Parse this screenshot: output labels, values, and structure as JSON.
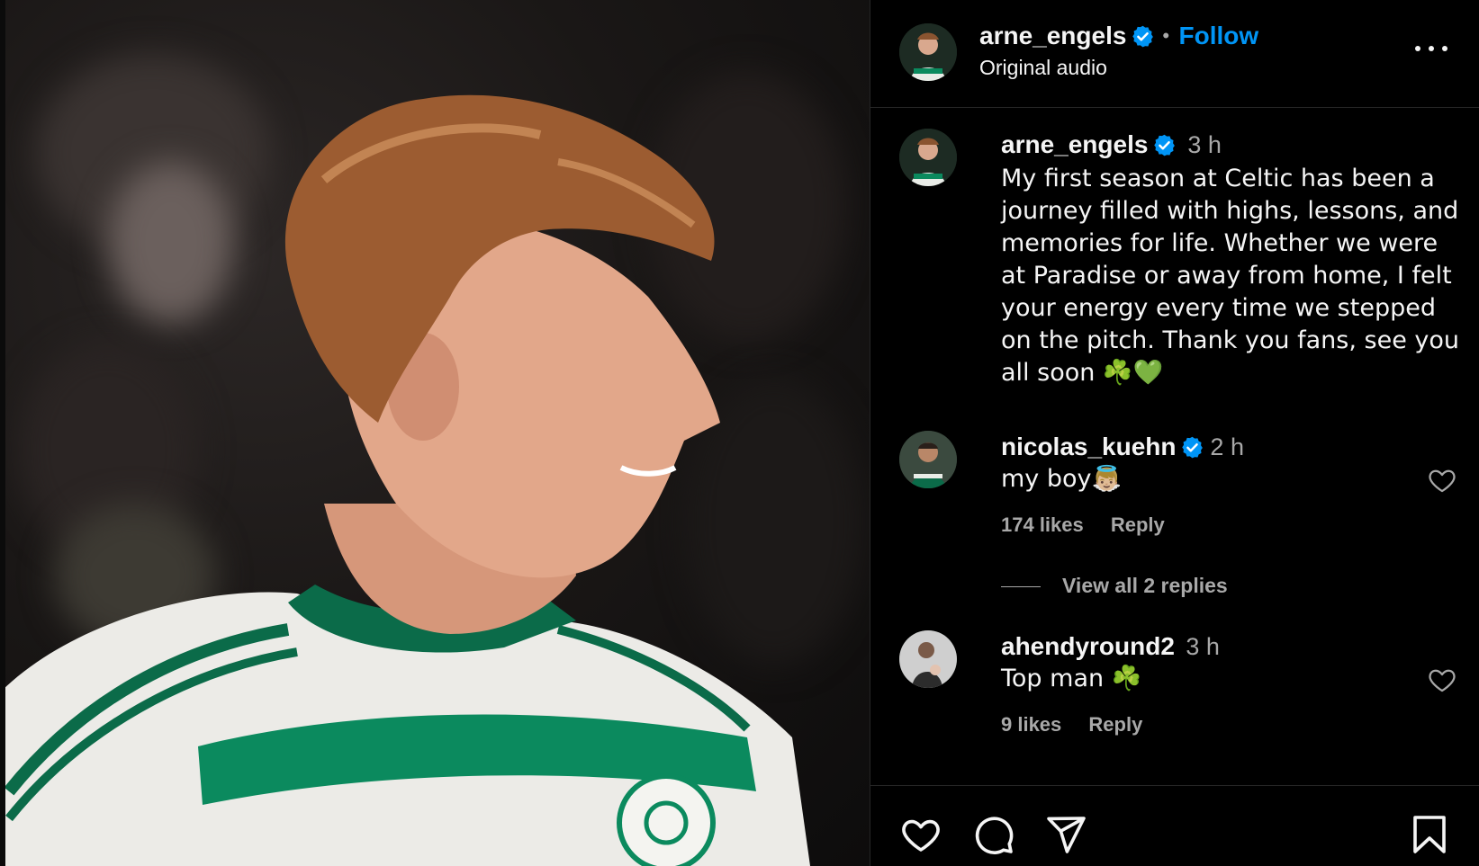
{
  "header": {
    "username": "arne_engels",
    "separator": "•",
    "follow_label": "Follow",
    "audio_label": "Original audio"
  },
  "caption": {
    "username": "arne_engels",
    "time": "3 h",
    "text": "My first season at Celtic has been a journey filled with highs, lessons, and memories for life. Whether we were at Paradise or away from home, I felt your energy every time we stepped on the pitch. Thank you fans, see you all soon ☘️💚"
  },
  "comments": [
    {
      "username": "nicolas_kuehn",
      "verified": true,
      "time": "2 h",
      "text": "my boy👼🏼",
      "likes": "174 likes",
      "reply_label": "Reply",
      "view_replies": "View all 2 replies"
    },
    {
      "username": "ahendyround2",
      "verified": false,
      "time": "3 h",
      "text": "Top man ☘️",
      "likes": "9 likes",
      "reply_label": "Reply"
    }
  ],
  "icons": {
    "more": "more-options-icon",
    "verified": "verified-badge-icon",
    "like": "heart-icon",
    "comment": "comment-icon",
    "share": "share-icon",
    "save": "bookmark-icon"
  },
  "colors": {
    "background": "#000000",
    "link_blue": "#0095f6",
    "verified_blue": "#0095f6",
    "secondary_text": "#a8a8a8",
    "divider": "#262626",
    "celtic_green": "#0b8a5e"
  }
}
